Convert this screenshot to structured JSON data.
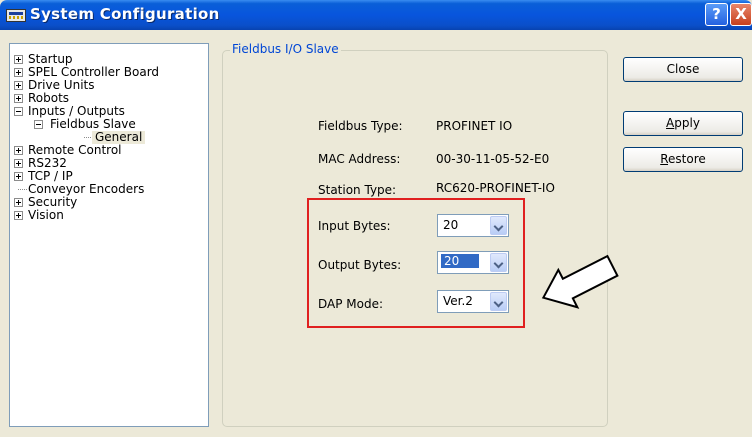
{
  "window": {
    "title": "System Configuration"
  },
  "titlebar": {
    "help": "?",
    "close": "X"
  },
  "tree": {
    "items": [
      {
        "label": "Startup",
        "expander": "plus"
      },
      {
        "label": "SPEL Controller Board",
        "expander": "plus"
      },
      {
        "label": "Drive Units",
        "expander": "plus"
      },
      {
        "label": "Robots",
        "expander": "plus"
      },
      {
        "label": "Inputs / Outputs",
        "expander": "minus"
      },
      {
        "label": "Fieldbus Slave",
        "expander": "minus"
      },
      {
        "label": "General",
        "expander": "none"
      },
      {
        "label": "Remote Control",
        "expander": "plus"
      },
      {
        "label": "RS232",
        "expander": "plus"
      },
      {
        "label": "TCP / IP",
        "expander": "plus"
      },
      {
        "label": "Conveyor Encoders",
        "expander": "none"
      },
      {
        "label": "Security",
        "expander": "plus"
      },
      {
        "label": "Vision",
        "expander": "plus"
      }
    ]
  },
  "panel": {
    "group_title": "Fieldbus I/O Slave",
    "fieldbus_type_label": "Fieldbus Type:",
    "fieldbus_type_value": "PROFINET IO",
    "mac_label": "MAC Address:",
    "mac_value": "00-30-11-05-52-E0",
    "station_label": "Station Type:",
    "station_value": "RC620-PROFINET-IO",
    "input_bytes_label": "Input Bytes:",
    "input_bytes_value": "20",
    "output_bytes_label": "Output Bytes:",
    "output_bytes_value": "20",
    "dap_label": "DAP Mode:",
    "dap_value": "Ver.2"
  },
  "buttons": {
    "close_label": "Close",
    "apply_underlined": "A",
    "apply_rest": "pply",
    "restore_underlined": "R",
    "restore_rest": "estore"
  },
  "colors": {
    "highlight": "#e02020",
    "title_bar": "#0855dd",
    "group_title": "#0046d5"
  }
}
